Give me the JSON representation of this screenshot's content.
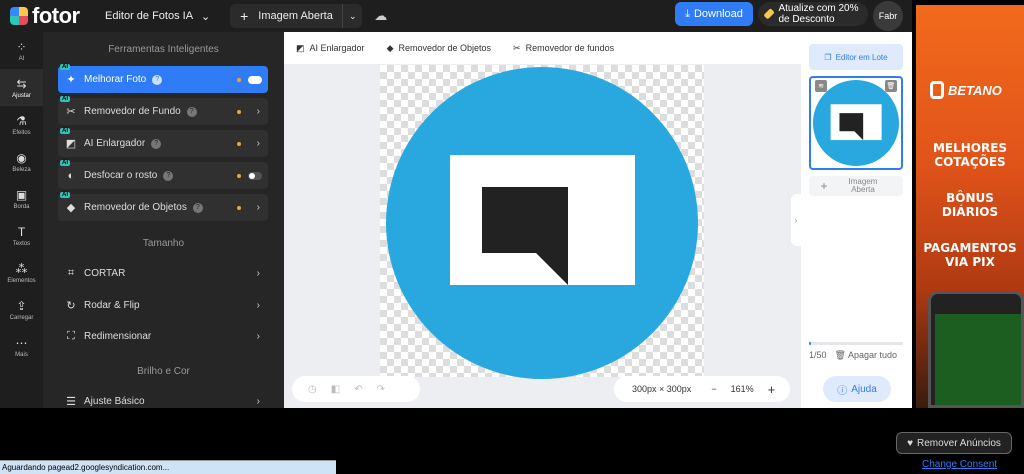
{
  "topbar": {
    "logo": "fotor",
    "editor_label": "Editor de Fotos IA",
    "open_image": "Imagem Aberta",
    "download": "Download",
    "upgrade": "Atualize com 20% de Desconto",
    "avatar": "Fabr"
  },
  "leftnav": [
    {
      "label": "AI",
      "icon": "ai-icon"
    },
    {
      "label": "Ajustar",
      "icon": "adjust-icon"
    },
    {
      "label": "Efeitos",
      "icon": "effects-icon"
    },
    {
      "label": "Beleza",
      "icon": "beauty-icon"
    },
    {
      "label": "Borda",
      "icon": "border-icon"
    },
    {
      "label": "Textos",
      "icon": "text-icon"
    },
    {
      "label": "Elementos",
      "icon": "elements-icon"
    },
    {
      "label": "Carregar",
      "icon": "upload-icon"
    },
    {
      "label": "Mais",
      "icon": "more-icon"
    }
  ],
  "tools": {
    "smart_title": "Ferramentas Inteligentes",
    "smart": [
      {
        "label": "Melhorar Foto",
        "badge": "AI"
      },
      {
        "label": "Removedor de Fundo",
        "badge": "AI"
      },
      {
        "label": "AI Enlargador",
        "badge": "AI"
      },
      {
        "label": "Desfocar o rosto",
        "badge": "AI"
      },
      {
        "label": "Removedor de Objetos",
        "badge": "AI"
      }
    ],
    "size_title": "Tamanho",
    "size": [
      "CORTAR",
      "Rodar & Flip",
      "Redimensionar"
    ],
    "color_title": "Brilho e Cor",
    "color": [
      "Ajuste Básico"
    ]
  },
  "workspace": {
    "toolbar": [
      "AI Enlargador",
      "Removedor de Objetos",
      "Removedor de fundos"
    ],
    "dimensions": "300px × 300px",
    "zoom": "161%"
  },
  "rightpanel": {
    "batch": "Editor em Lote",
    "add_image": "Imagem Aberta",
    "count": "1/50",
    "progress": 0.02,
    "clear_all": "Apagar tudo",
    "help": "Ajuda"
  },
  "ad": {
    "brand": "BETANO",
    "lines": [
      "MELHORES COTAÇÕES",
      "BÔNUS DIÁRIOS",
      "PAGAMENTOS VIA PIX"
    ]
  },
  "remove_ads": "Remover Anúncios",
  "change_consent": "Change Consent",
  "status": "Aguardando pagead2.googlesyndication.com..."
}
